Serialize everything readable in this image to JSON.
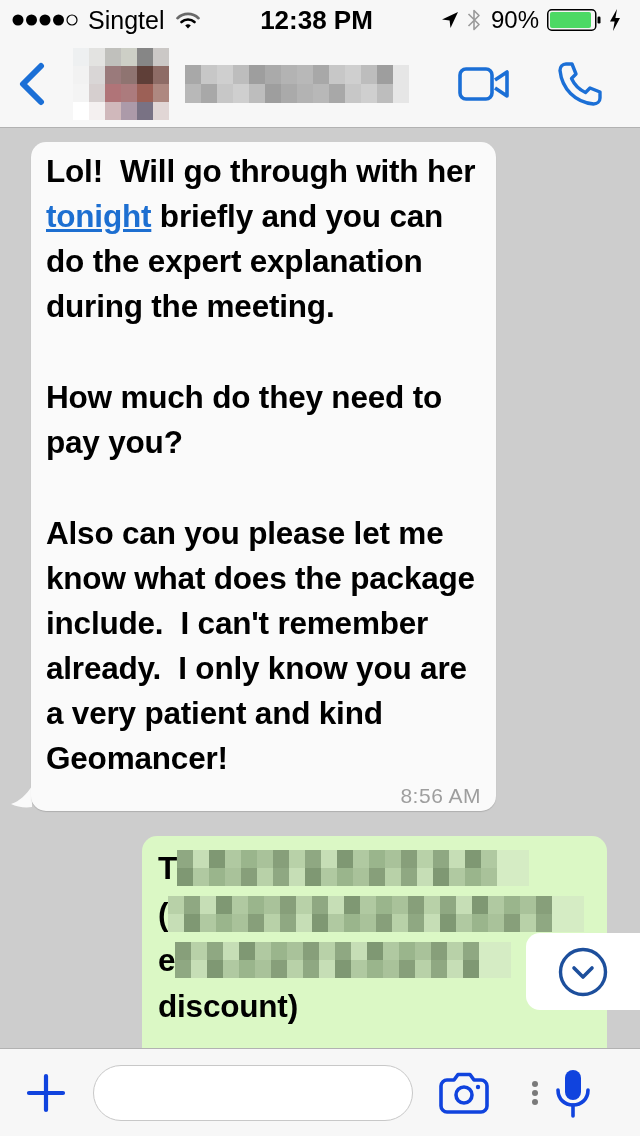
{
  "status_bar": {
    "carrier": "Singtel",
    "time": "12:38 PM",
    "battery": "90%"
  },
  "messages": [
    {
      "kind": "incoming",
      "paragraphs": [
        [
          {
            "kind": "text",
            "text": "Lol!  Will go through with her "
          },
          {
            "kind": "link",
            "text": "tonight"
          },
          {
            "kind": "text",
            "text": " briefly and you can do the expert explanation during the meeting."
          }
        ],
        [
          {
            "kind": "text",
            "text": "How much do they need to pay you?"
          }
        ],
        [
          {
            "kind": "text",
            "text": "Also can you please let me know what does the package include.  I can't remember already.  I only know you are a very patient and kind Geomancer!"
          }
        ]
      ],
      "time": "8:56 AM"
    },
    {
      "kind": "outgoing",
      "lines": [
        {
          "text": "T",
          "redacted": true
        },
        {
          "text": "(",
          "redacted": true
        },
        {
          "text": "e",
          "redacted": true
        },
        {
          "text": "discount)",
          "redacted": false
        }
      ]
    }
  ]
}
